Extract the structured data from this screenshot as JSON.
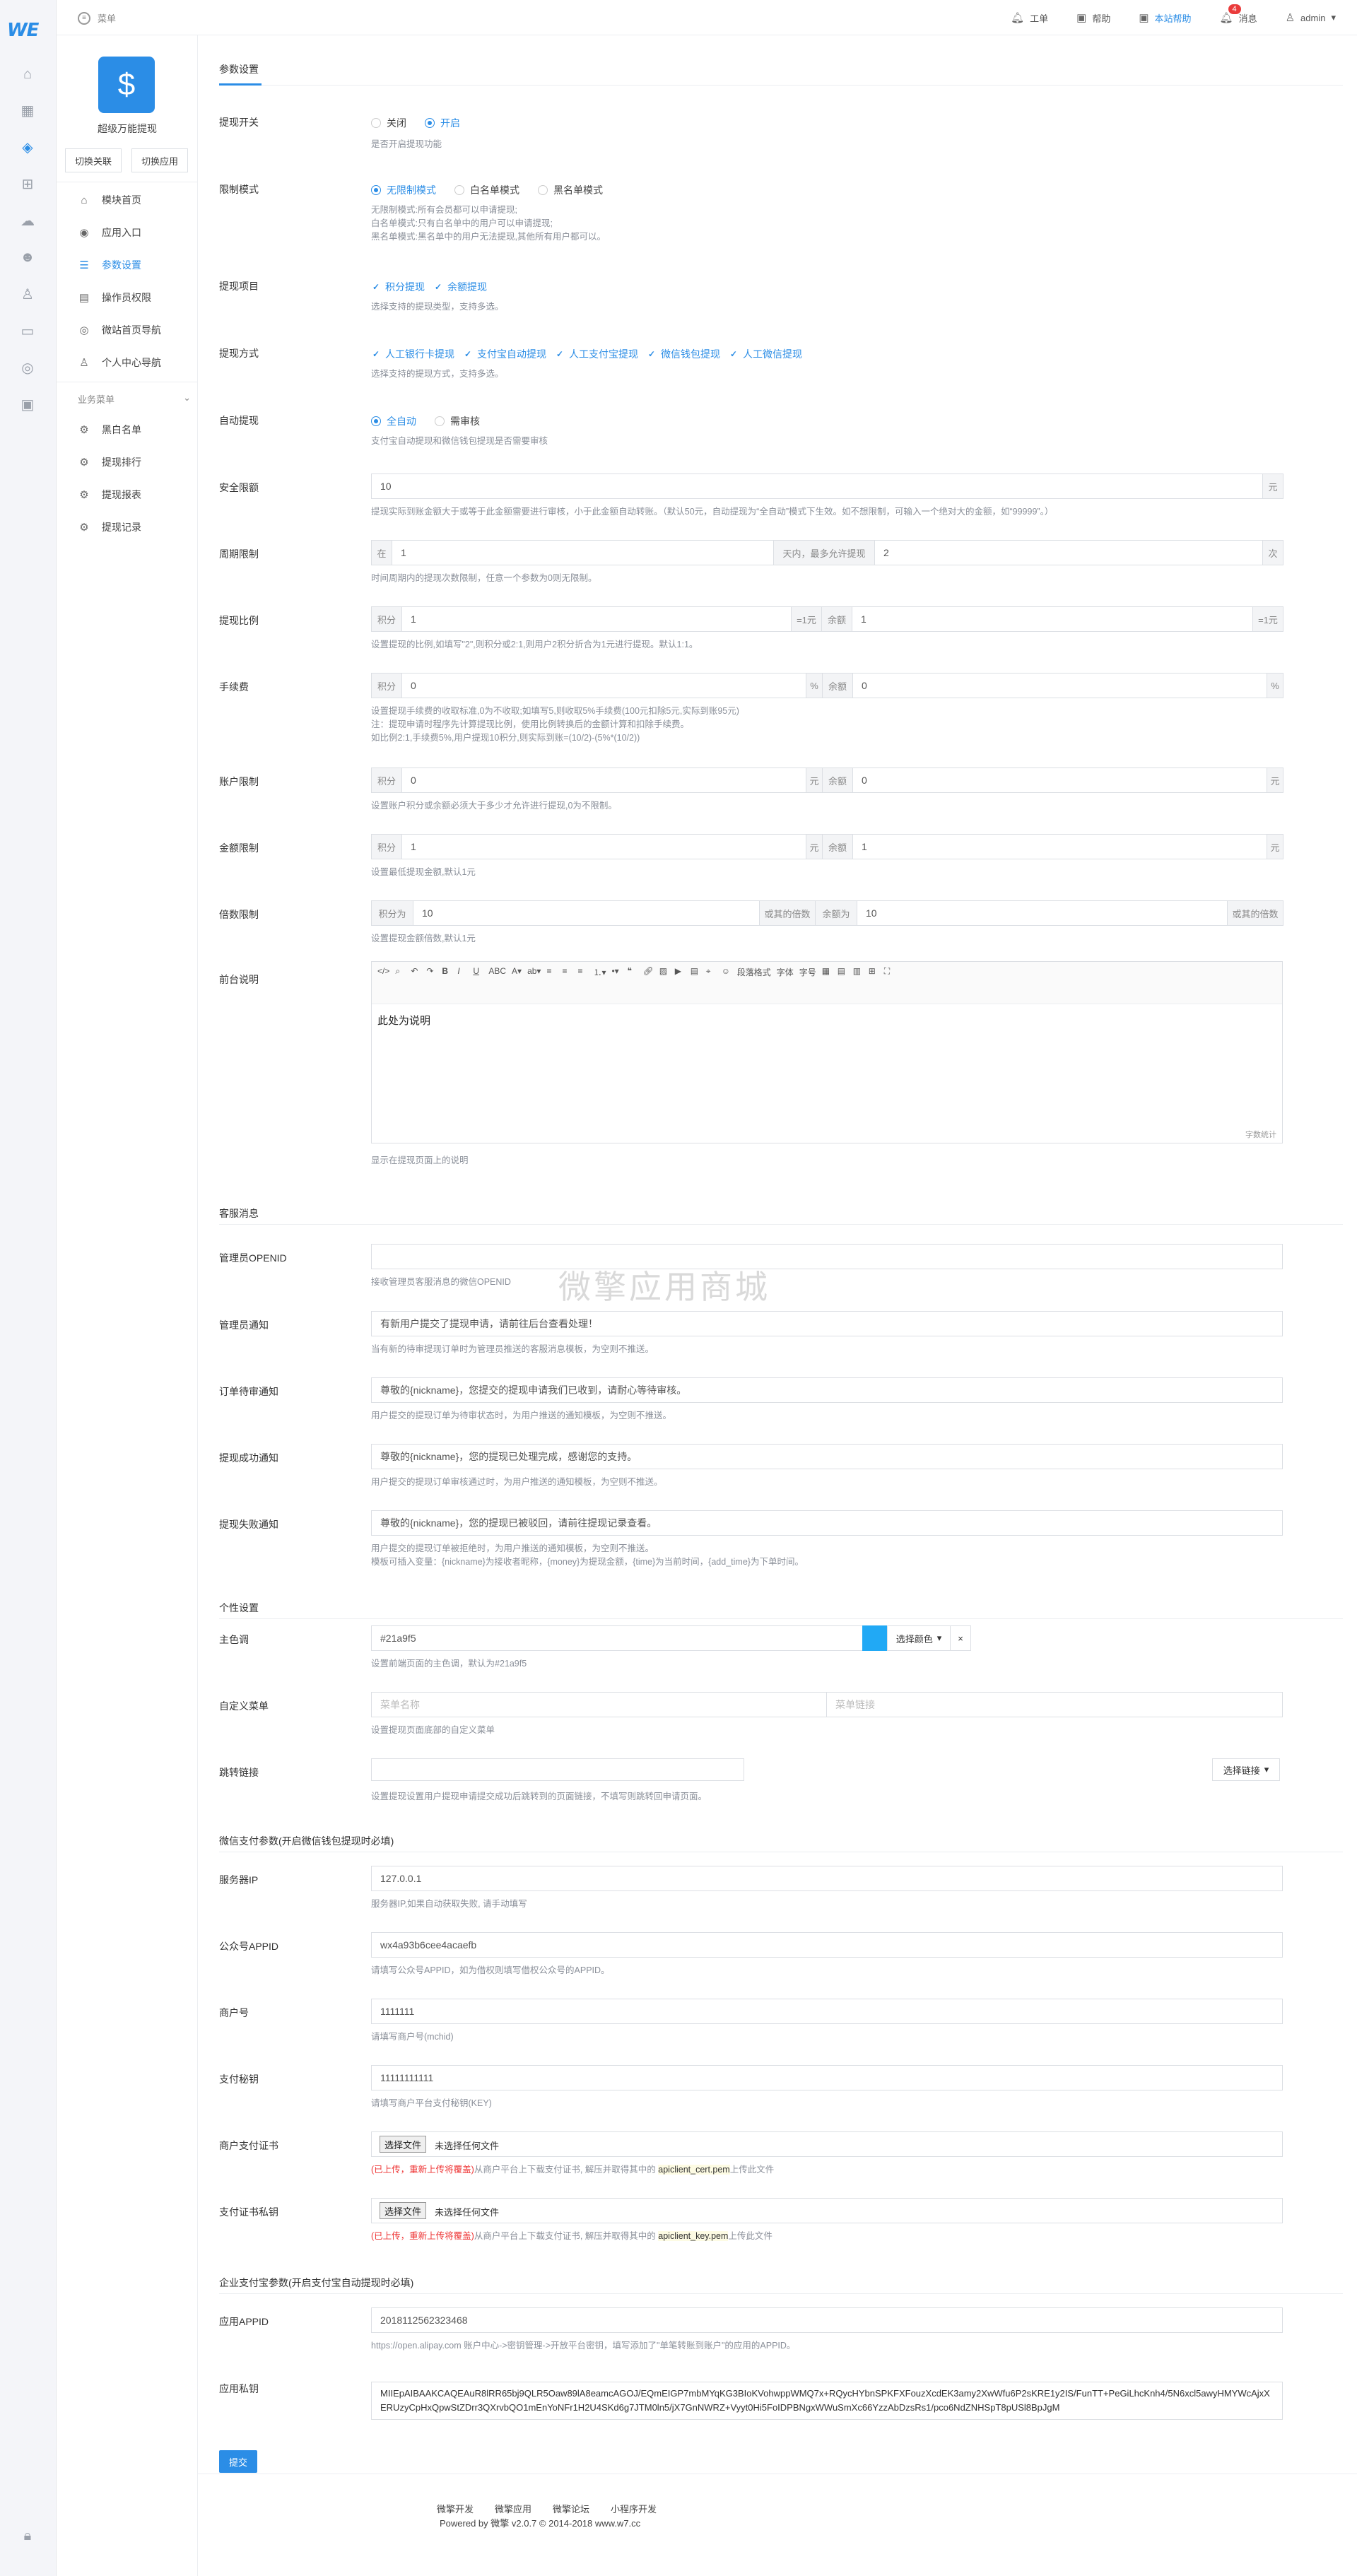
{
  "topbar": {
    "menu_label": "菜单",
    "items": [
      {
        "label": "工单",
        "icon": "bell-icon"
      },
      {
        "label": "帮助",
        "icon": "help-icon"
      },
      {
        "label": "本站帮助",
        "icon": "help-icon"
      },
      {
        "label": "消息",
        "icon": "bell-icon"
      },
      {
        "label": "admin",
        "icon": "user-icon"
      }
    ],
    "badge": "4"
  },
  "rail": {
    "logo": "WE"
  },
  "sidebar": {
    "app_name": "超级万能提现",
    "switch_buttons": [
      "切换关联",
      "切换应用"
    ],
    "items": [
      "模块首页",
      "应用入口",
      "参数设置",
      "操作员权限",
      "微站首页导航",
      "个人中心导航"
    ],
    "group_label": "业务菜单",
    "group_items": [
      "黑白名单",
      "提现排行",
      "提现报表",
      "提现记录"
    ]
  },
  "page": {
    "breadcrumb": "参数设置",
    "submit": "提交"
  },
  "form": {
    "switch": {
      "label": "提现开关",
      "options": [
        "关闭",
        "开启"
      ],
      "help": "是否开启提现功能"
    },
    "limit_mode": {
      "label": "限制模式",
      "options": [
        "无限制模式",
        "白名单模式",
        "黑名单模式"
      ],
      "help": [
        "无限制模式:所有会员都可以申请提现;",
        "白名单模式:只有白名单中的用户可以申请提现;",
        "黑名单模式:黑名单中的用户无法提现,其他所有用户都可以。"
      ]
    },
    "items": {
      "label": "提现项目",
      "options": [
        "积分提现",
        "余额提现"
      ],
      "help": "选择支持的提现类型，支持多选。"
    },
    "methods": {
      "label": "提现方式",
      "options": [
        "人工银行卡提现",
        "支付宝自动提现",
        "人工支付宝提现",
        "微信钱包提现",
        "人工微信提现"
      ],
      "help": "选择支持的提现方式，支持多选。"
    },
    "auto": {
      "label": "自动提现",
      "options": [
        "全自动",
        "需审核"
      ],
      "help": "支付宝自动提现和微信钱包提现是否需要审核"
    },
    "safe": {
      "label": "安全限额",
      "value": "10",
      "addon": "元",
      "help": "提现实际到账金额大于或等于此金额需要进行审核，小于此金额自动转账。（默认50元，自动提现为“全自动”模式下生效。如不想限制，可输入一个绝对大的金额，如“99999”。）"
    },
    "period": {
      "label": "周期限制",
      "pre": "在",
      "value1": "1",
      "mid": "天内，最多允许提现",
      "value2": "2",
      "post": "次",
      "help": "时间周期内的提现次数限制，任意一个参数为0则无限制。"
    },
    "ratio": {
      "label": "提现比例",
      "pre1": "积分",
      "value1": "1",
      "post1": "=1元",
      "pre2": "余额",
      "value2": "1",
      "post2": "=1元",
      "help": "设置提现的比例,如填写\"2\",则积分或2:1,则用户2积分折合为1元进行提现。默认1:1。"
    },
    "fee": {
      "label": "手续费",
      "pre1": "积分",
      "value1": "0",
      "post1": "%",
      "pre2": "余额",
      "value2": "0",
      "post2": "%",
      "help": [
        "设置提现手续费的收取标准,0为不收取;如填写5,则收取5%手续费(100元扣除5元,实际到账95元)",
        "注：提现申请时程序先计算提现比例，使用比例转换后的金额计算和扣除手续费。",
        "如比例2:1,手续费5%,用户提现10积分,则实际到账=(10/2)-(5%*(10/2))"
      ]
    },
    "account": {
      "label": "账户限制",
      "pre1": "积分",
      "value1": "0",
      "post1": "元",
      "pre2": "余额",
      "value2": "0",
      "post2": "元",
      "help": "设置账户积分或余额必须大于多少才允许进行提现,0为不限制。"
    },
    "min_amount": {
      "label": "金额限制",
      "pre1": "积分",
      "value1": "1",
      "post1": "元",
      "pre2": "余额",
      "value2": "1",
      "post2": "元",
      "help": "设置最低提现金额,默认1元"
    },
    "multiple": {
      "label": "倍数限制",
      "pre1": "积分为",
      "value1": "10",
      "post1": "或其的倍数",
      "pre2": "余额为",
      "value2": "10",
      "post2": "或其的倍数",
      "help": "设置提现金额倍数,默认1元"
    },
    "notice": {
      "label": "前台说明",
      "toolbar_selects": [
        "段落格式",
        "字体",
        "字号"
      ],
      "content": "此处为说明",
      "count": "字数统计",
      "help": "显示在提现页面上的说明"
    }
  },
  "customer_msg": {
    "title": "客服消息",
    "openid": {
      "label": "管理员OPENID",
      "value": "",
      "help": "接收管理员客服消息的微信OPENID"
    },
    "admin_notice": {
      "label": "管理员通知",
      "value": "有新用户提交了提现申请，请前往后台查看处理！",
      "help": "当有新的待审提现订单时为管理员推送的客服消息模板，为空则不推送。"
    },
    "wait_notice": {
      "label": "订单待审通知",
      "value": "尊敬的{nickname}，您提交的提现申请我们已收到，请耐心等待审核。",
      "help": "用户提交的提现订单为待审状态时，为用户推送的通知模板，为空则不推送。"
    },
    "success_notice": {
      "label": "提现成功通知",
      "value": "尊敬的{nickname}，您的提现已处理完成，感谢您的支持。",
      "help": "用户提交的提现订单审核通过时，为用户推送的通知模板，为空则不推送。"
    },
    "fail_notice": {
      "label": "提现失败通知",
      "value": "尊敬的{nickname}，您的提现已被驳回，请前往提现记录查看。",
      "help": [
        "用户提交的提现订单被拒绝时，为用户推送的通知模板，为空则不推送。",
        "模板可插入变量：{nickname}为接收者昵称，{money}为提现金额，{time}为当前时间，{add_time}为下单时间。"
      ]
    }
  },
  "personal": {
    "title": "个性设置",
    "color": {
      "label": "主色调",
      "value": "#21a9f5",
      "button": "选择颜色",
      "clear": "×",
      "help": "设置前端页面的主色调，默认为#21a9f5",
      "swatch_color": "#21a9f5"
    },
    "menu": {
      "label": "自定义菜单",
      "ph1": "菜单名称",
      "ph2": "菜单链接",
      "help": "设置提现页面底部的自定义菜单"
    },
    "jump": {
      "label": "跳转链接",
      "value": "",
      "button": "选择链接",
      "help": "设置提现设置用户提现申请提交成功后跳转到的页面链接，不填写则跳转回申请页面。"
    }
  },
  "wechat": {
    "title": "微信支付参数(开启微信钱包提现时必填)",
    "ip": {
      "label": "服务器IP",
      "value": "127.0.0.1",
      "help": "服务器IP,如果自动获取失败, 请手动填写"
    },
    "appid": {
      "label": "公众号APPID",
      "value": "wx4a93b6cee4acaefb",
      "help": "请填写公众号APPID，如为借权则填写借权公众号的APPID。"
    },
    "mchid": {
      "label": "商户号",
      "value": "1111111",
      "help": "请填写商户号(mchid)"
    },
    "key": {
      "label": "支付秘钥",
      "value": "11111111111",
      "help": "请填写商户平台支付秘钥(KEY)"
    },
    "cert": {
      "label": "商户支付证书",
      "btn": "选择文件",
      "none": "未选择任何文件",
      "uploaded": "(已上传，重新上传将覆盖)",
      "help": "从商户平台上下载支付证书, 解压并取得其中的",
      "file": "apiclient_cert.pem",
      "tail": "上传此文件"
    },
    "certkey": {
      "label": "支付证书私钥",
      "btn": "选择文件",
      "none": "未选择任何文件",
      "uploaded": "(已上传，重新上传将覆盖)",
      "help": "从商户平台上下载支付证书, 解压并取得其中的",
      "file": "apiclient_key.pem",
      "tail": "上传此文件"
    }
  },
  "alipay": {
    "title": "企业支付宝参数(开启支付宝自动提现时必填)",
    "appid": {
      "label": "应用APPID",
      "value": "2018112562323468",
      "help": "https://open.alipay.com 账户中心->密钥管理->开放平台密钥，填写添加了\"单笔转账到账户\"的应用的APPID。"
    },
    "key": {
      "label": "应用私钥",
      "value": "MIIEpAIBAAKCAQEAuR8lRR65bj9QLR5Oaw89lA8eamcAGOJ/EQmEIGP7mbMYqKG3BIoKVohwppWMQ7x+RQycHYbnSPKFXFouzXcdEK3amy2XwWfu6P2sKRE1y2IS/FunTT+PeGiLhcKnh4/5N6xcl5awyHMYWcAjxXERUzyCpHxQpwStZDrr3QXrvbQO1mEnYoNFr1H2U4SKd6g7JTM0ln5/jX7GnNWRZ+Vyyt0Hi5FoIDPBNgxWWuSmXc66YzzAbDzsRs1/pco6NdZNHSpT8pUSl8BpJgM"
    }
  },
  "footer": {
    "links": [
      "微擎开发",
      "微擎应用",
      "微擎论坛",
      "小程序开发"
    ],
    "copy": "Powered by 微擎 v2.0.7 © 2014-2018 www.w7.cc"
  },
  "watermark": "微擎应用商城"
}
